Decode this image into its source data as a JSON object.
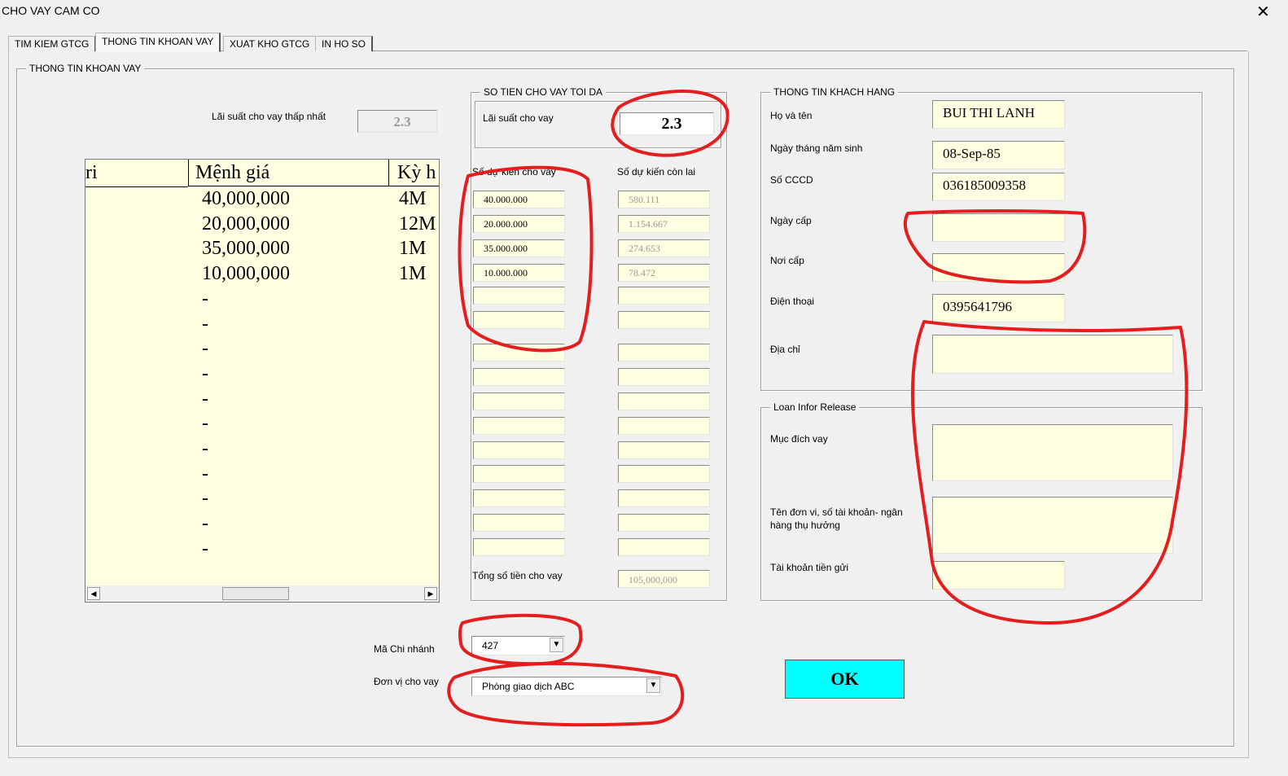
{
  "window": {
    "title": "CHO VAY CAM CO",
    "close_label": "✕"
  },
  "tabs": [
    {
      "label": "TIM KIEM GTCG"
    },
    {
      "label": "THONG TIN KHOAN VAY"
    },
    {
      "label": "XUAT KHO GTCG"
    },
    {
      "label": "IN HO SO"
    }
  ],
  "loan": {
    "frame_title": "THONG TIN KHOAN VAY",
    "min_rate_label": "Lãi suất cho vay thấp nhất",
    "min_rate_value": "2.3"
  },
  "list": {
    "headers": [
      "ri",
      "Mệnh giá",
      "Kỳ h"
    ],
    "rows": [
      {
        "value": "40,000,000",
        "term": "4M"
      },
      {
        "value": "20,000,000",
        "term": "12M"
      },
      {
        "value": "35,000,000",
        "term": "1M"
      },
      {
        "value": "10,000,000",
        "term": "1M"
      },
      {
        "value": "-",
        "term": ""
      },
      {
        "value": "-",
        "term": ""
      },
      {
        "value": "-",
        "term": ""
      },
      {
        "value": "-",
        "term": ""
      },
      {
        "value": "-",
        "term": ""
      },
      {
        "value": "-",
        "term": ""
      },
      {
        "value": "-",
        "term": ""
      },
      {
        "value": "-",
        "term": ""
      },
      {
        "value": "-",
        "term": ""
      },
      {
        "value": "-",
        "term": ""
      },
      {
        "value": "-",
        "term": ""
      }
    ],
    "scroll_left": "◀",
    "scroll_right": "▶"
  },
  "max_loan": {
    "frame_title": "SO TIEN CHO VAY TOI DA",
    "rate_label": "Lãi suất cho vay",
    "rate_value": "2.3",
    "col1_label": "Số dự kiến cho vay",
    "col2_label": "Số dự kiến còn lai",
    "col1": [
      "40.000.000",
      "20.000.000",
      "35.000.000",
      "10.000.000",
      "",
      "",
      "",
      "",
      "",
      "",
      "",
      "",
      "",
      "",
      ""
    ],
    "col2": [
      "580.111",
      "1.154.667",
      "274.653",
      "78.472",
      "",
      "",
      "",
      "",
      "",
      "",
      "",
      "",
      "",
      "",
      ""
    ],
    "total_label": "Tổng số tiền cho vay",
    "total_value": "105,000,000"
  },
  "customer": {
    "frame_title": "THONG TIN KHACH HANG",
    "name_label": "Họ và tên",
    "name_value": "BUI THI LANH",
    "dob_label": "Ngày tháng năm sinh",
    "dob_value": "08-Sep-85",
    "id_label": "Số CCCD",
    "id_value": "036185009358",
    "issue_date_label": "Ngày cấp",
    "issue_date_value": "",
    "issue_place_label": "Nơi cấp",
    "issue_place_value": "",
    "phone_label": "Điện thoại",
    "phone_value": "0395641796",
    "address_label": "Địa chỉ",
    "address_value": ""
  },
  "release": {
    "frame_title": "Loan Infor Release",
    "purpose_label": "Mục đích vay",
    "purpose_value": "",
    "beneficiary_label": "Tên đơn vi, số tài khoản- ngân hàng thụ hưởng",
    "beneficiary_value": "",
    "deposit_label": "Tài khoản tiền gửi",
    "deposit_value": ""
  },
  "branch": {
    "code_label": "Mã Chi nhánh",
    "code_value": "427",
    "unit_label": "Đơn vị cho vay",
    "unit_value": "Phòng giao dịch ABC"
  },
  "ok_label": "OK",
  "colors": {
    "field_bg": "#ffffe1",
    "ok_bg": "#00ffff",
    "annotation": "#e41e1e"
  }
}
